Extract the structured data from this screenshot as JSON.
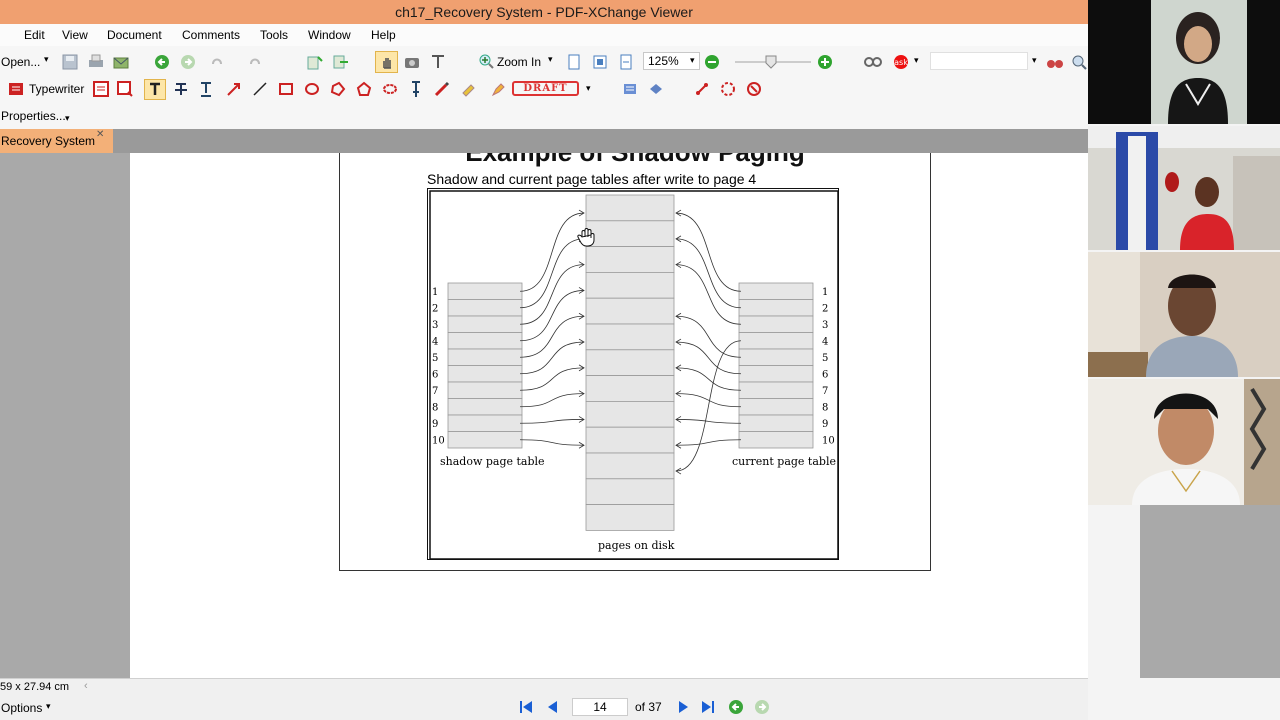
{
  "window": {
    "title": "ch17_Recovery System - PDF-XChange Viewer"
  },
  "menu": [
    "Edit",
    "View",
    "Document",
    "Comments",
    "Tools",
    "Window",
    "Help"
  ],
  "toolbar": {
    "open_label": "Open...",
    "zoom_in_label": "Zoom In",
    "zoom_value": "125%",
    "typewriter_label": "Typewriter",
    "draft_label": "DRAFT",
    "properties_label": "Properties..."
  },
  "tab": {
    "label": "Recovery System"
  },
  "slide": {
    "title": "Example of Shadow Paging",
    "subtitle": "Shadow and current page tables after write to page 4",
    "shadow_label": "shadow page table",
    "current_label": "current page table",
    "disk_label": "pages on disk",
    "row_numbers": [
      "1",
      "2",
      "3",
      "4",
      "5",
      "6",
      "7",
      "8",
      "9",
      "10"
    ]
  },
  "status": {
    "page_size": "59 x 27.94 cm",
    "options_label": "Options",
    "current_page": "14",
    "page_count": "of 37"
  },
  "colors": {
    "titlebar": "#f0a070",
    "tab_active": "#f3b078",
    "doc_background": "#a9a9a9"
  }
}
